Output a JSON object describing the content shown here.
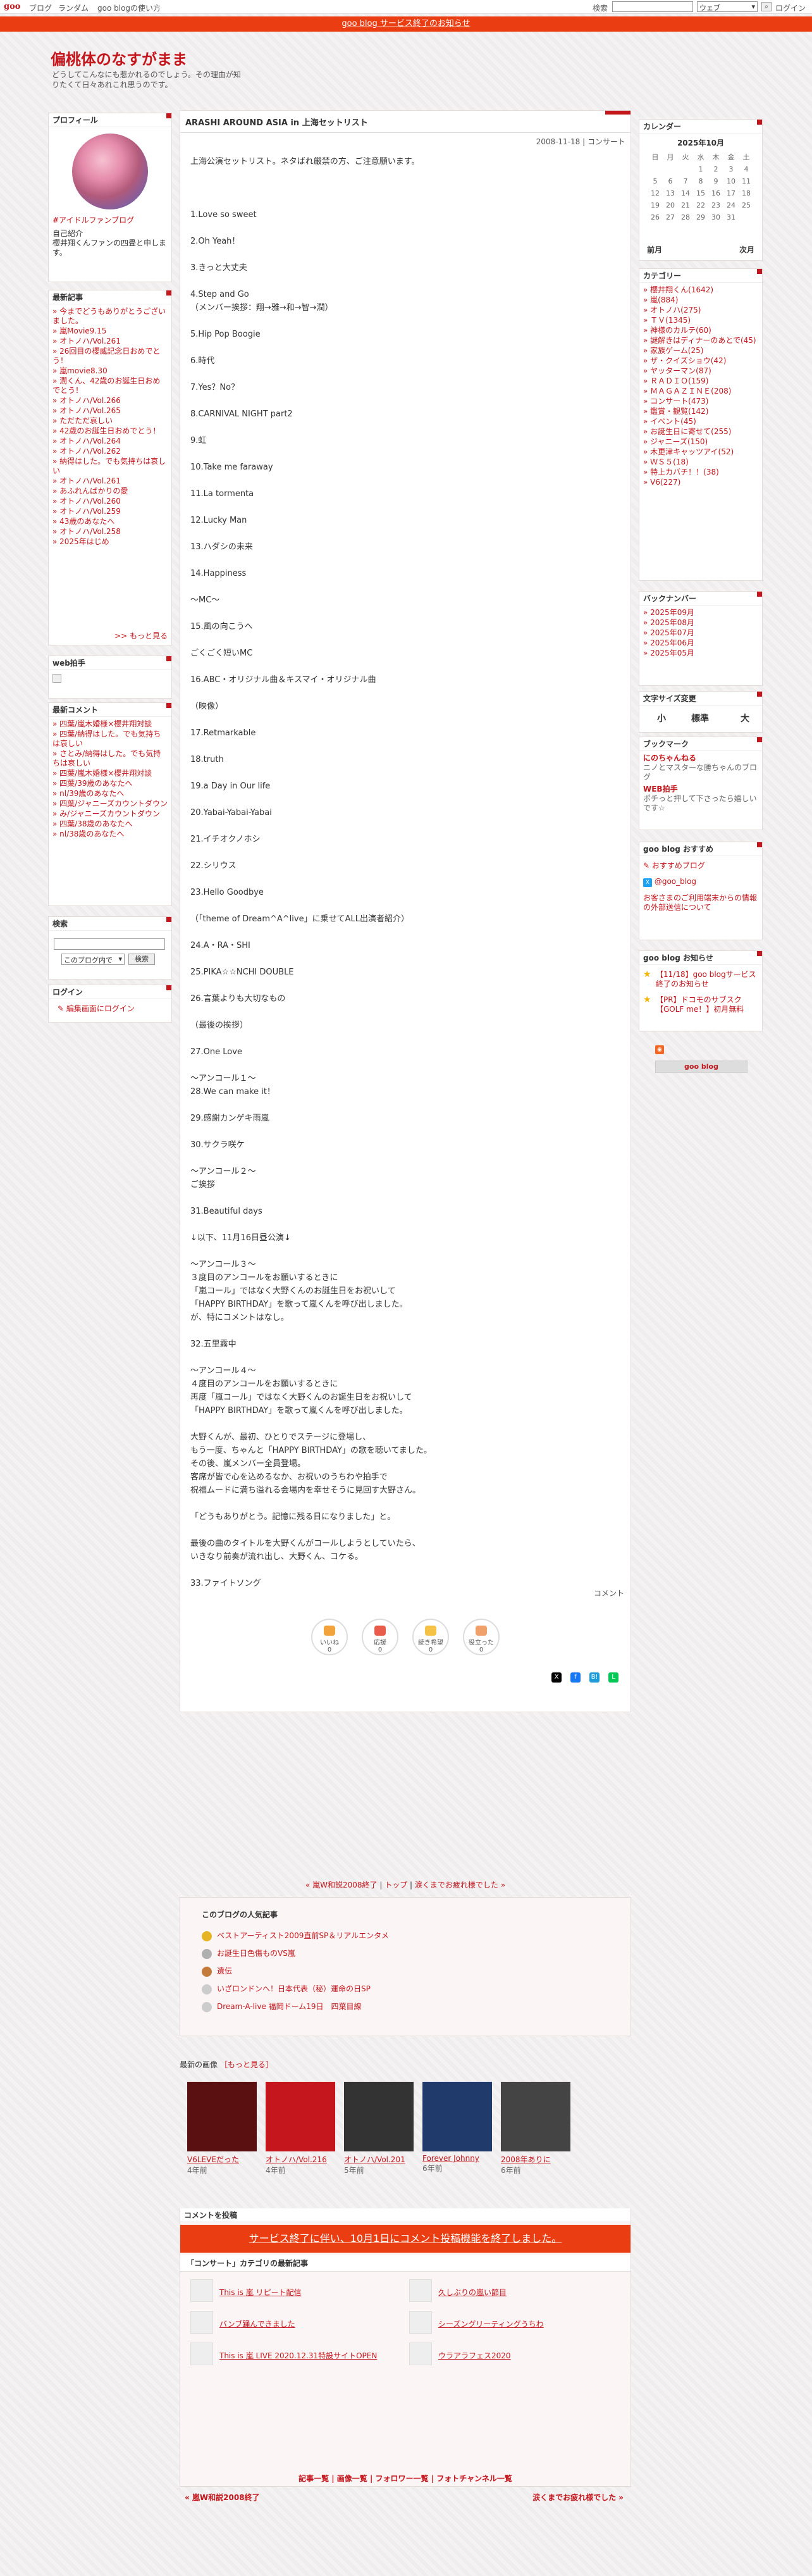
{
  "topbar": {
    "logo": "goo",
    "links": [
      "ブログ",
      "ランダム",
      "goo blogの使い方"
    ],
    "search_label": "検索",
    "search_placeholder": "",
    "search_scope": "ウェブ",
    "login": "ログイン"
  },
  "notice": "goo blog サービス終了のお知らせ",
  "blog": {
    "title": "偏桃体のなすがまま",
    "description": "どうしてこんなにも惹かれるのでしょう。その理由が知りたくて日々あれこれ思うのです。"
  },
  "profile": {
    "heading": "プロフィール",
    "name": "#アイドルファンブログ",
    "intro_label": "自己紹介",
    "intro": "櫻井翔くんファンの四畳と申します。"
  },
  "recent": {
    "heading": "最新記事",
    "items": [
      "今までどうもありがとうございました。",
      "嵐Movie9.15",
      "オトノハ/Vol.261",
      "26回目の櫻威記念日おめでとう！",
      "嵐movie8.30",
      "潤くん、42歳のお誕生日おめでとう！",
      "オトノハ/Vol.266",
      "オトノハ/Vol.265",
      "ただただ哀しい",
      "42歳のお誕生日おめでとう！",
      "オトノハ/Vol.264",
      "オトノハ/Vol.262",
      "納得はした。でも気持ちは哀しい",
      "オトノハ/Vol.261",
      "あふれんばかりの愛",
      "オトノハ/Vol.260",
      "オトノハ/Vol.259",
      "43歳のあなたへ",
      "オトノハ/Vol.258",
      "2025年はじめ"
    ],
    "more": ">> もっと見る"
  },
  "clap": {
    "heading": "web拍手"
  },
  "comments": {
    "heading": "最新コメント",
    "items": [
      "四葉/嵐木婚様×櫻井翔対談",
      "四葉/納得はした。でも気持ちは哀しい",
      "さとみ/納得はした。でも気持ちは哀しい",
      "四葉/嵐木婚様×櫻井翔対談",
      "四葉/39歳のあなたへ",
      "nl/39歳のあなたへ",
      "四葉/ジャニーズカウントダウン",
      "み/ジャニーズカウントダウン",
      "四葉/38歳のあなたへ",
      "nl/38歳のあなたへ"
    ]
  },
  "search": {
    "heading": "検索",
    "scope": "このブログ内で",
    "button": "検索"
  },
  "login": {
    "heading": "ログイン",
    "link": "編集画面にログイン"
  },
  "calendar": {
    "heading": "カレンダー",
    "month": "2025年10月",
    "weekdays": [
      "日",
      "月",
      "火",
      "水",
      "木",
      "金",
      "土"
    ],
    "rows": [
      [
        "",
        "",
        "",
        "1",
        "2",
        "3",
        "4"
      ],
      [
        "5",
        "6",
        "7",
        "8",
        "9",
        "10",
        "11"
      ],
      [
        "12",
        "13",
        "14",
        "15",
        "16",
        "17",
        "18"
      ],
      [
        "19",
        "20",
        "21",
        "22",
        "23",
        "24",
        "25"
      ],
      [
        "26",
        "27",
        "28",
        "29",
        "30",
        "31",
        ""
      ]
    ],
    "prev": "前月",
    "next": "次月"
  },
  "categories": {
    "heading": "カテゴリー",
    "items": [
      "櫻井翔くん(1642)",
      "嵐(884)",
      "オトノハ(275)",
      "ＴＶ(1345)",
      "神様のカルテ(60)",
      "謎解きはディナーのあとで(45)",
      "家族ゲーム(25)",
      "ザ・クイズショウ(42)",
      "ヤッターマン(87)",
      "ＲＡＤＩＯ(159)",
      "ＭＡＧＡＺＩＮＥ(208)",
      "コンサート(473)",
      "鑑賞・観覧(142)",
      "イベント(45)",
      "お誕生日に寄せて(255)",
      "ジャニーズ(150)",
      "木更津キャッツアイ(52)",
      "ＷＳ５(18)",
      "特上カバチ！！(38)",
      "V6(227)"
    ]
  },
  "backnumber": {
    "heading": "バックナンバー",
    "items": [
      "2025年09月",
      "2025年08月",
      "2025年07月",
      "2025年06月",
      "2025年05月"
    ]
  },
  "fontsize": {
    "heading": "文字サイズ変更",
    "small": "小",
    "mid": "標準",
    "large": "大"
  },
  "bookmark": {
    "heading": "ブックマーク",
    "items": [
      {
        "title": "にのちゃんねる",
        "desc": "ニノとマスターな勝ちゃんのブログ"
      },
      {
        "title": "WEB拍手",
        "desc": "ポチっと押して下さったら嬉しいです☆"
      }
    ]
  },
  "recommend": {
    "heading": "goo blog おすすめ",
    "items": [
      "おすすめブログ",
      "@goo_blog",
      "お客さまのご利用端末からの情報の外部送信について"
    ]
  },
  "news": {
    "heading": "goo blog お知らせ",
    "items": [
      "【11/18】goo blogサービス終了のお知らせ",
      "【PR】ドコモのサブスク【GOLF me！】初月無料"
    ]
  },
  "footerlogo": "goo blog",
  "entry": {
    "title": "ARASHI AROUND ASIA in 上海セットリスト",
    "date": "2008-11-18",
    "date_sep": " | ",
    "category": "コンサート",
    "body": "上海公演セットリスト。ネタばれ厳禁の方、ご注意願います。\n\n\n\n1.Love so sweet\n\n2.Oh Yeah！\n\n3.きっと大丈夫\n\n4.Step and Go\n（メンバー挨拶：翔→雅→和→智→潤）\n\n5.Hip Pop Boogie\n\n6.時代\n\n7.Yes？No？\n\n8.CARNIVAL NIGHT part2\n\n9.虹\n\n10.Take me faraway\n\n11.La tormenta\n\n12.Lucky Man\n\n13.ハダシの未来\n\n14.Happiness\n\n〜MC〜\n\n15.風の向こうへ\n\nごくごく短いMC\n\n16.ABC・オリジナル曲＆キスマイ・オリジナル曲\n\n（映像）\n\n17.Retmarkable\n\n18.truth\n\n19.a Day in Our life\n\n20.Yabai-Yabai-Yabai\n\n21.イチオクノホシ\n\n22.シリウス\n\n23.Hello Goodbye\n\n（「theme of Dream^A^live」に乗せてALL出演者紹介）\n\n24.A・RA・SHI\n\n25.PIKA☆☆NCHI DOUBLE\n\n26.言葉よりも大切なもの\n\n（最後の挨拶）\n\n27.One Love\n\n〜アンコール１〜\n28.We can make it！\n\n29.感謝カンゲキ雨嵐\n\n30.サクラ咲ケ\n\n〜アンコール２〜\nご挨拶\n\n31.Beautiful days\n\n↓以下、11月16日昼公演↓\n\n〜アンコール３〜\n３度目のアンコールをお願いするときに\n「嵐コール」ではなく大野くんのお誕生日をお祝いして\n「HAPPY BIRTHDAY」を歌って嵐くんを呼び出しました。\nが、特にコメントはなし。\n\n32.五里霧中\n\n〜アンコール４〜\n４度目のアンコールをお願いするときに\n再度「嵐コール」ではなく大野くんのお誕生日をお祝いして\n「HAPPY BIRTHDAY」を歌って嵐くんを呼び出しました。\n\n大野くんが、最初、ひとりでステージに登場し、\nもう一度、ちゃんと「HAPPY BIRTHDAY」の歌を聴いてました。\nその後、嵐メンバー全員登場。\n客席が皆で心を込めるなか、お祝いのうちわや拍手で\n祝福ムードに満ち溢れる会場内を幸せそうに見回す大野さん。\n\n「どうもありがとう。記憶に残る日になりました」と。\n\n最後の曲のタイトルを大野くんがコールしようとしていたら、\nいきなり前奏が流れ出し、大野くん、コケる。\n\n33.ファイトソング",
    "comment_link": "コメント",
    "reactions": [
      {
        "label": "いいね",
        "count": "0"
      },
      {
        "label": "応援",
        "count": "0"
      },
      {
        "label": "続き希望",
        "count": "0"
      },
      {
        "label": "役立った",
        "count": "0"
      }
    ],
    "share": [
      "X",
      "f",
      "B!",
      "L"
    ]
  },
  "pager": {
    "prev": "« 嵐W和説2008終了",
    "top": "トップ",
    "next": "涙くまでお疲れ様でした »"
  },
  "popular": {
    "heading": "このブログの人気記事",
    "items": [
      "ベストアーティスト2009直前SP＆リアルエンタメ",
      "お誕生日色傷ものVS嵐",
      "遺伝",
      "いざロンドンへ！日本代表（秘）運命の日SP",
      "Dream-A-live 福岡ドーム19日　四葉目線"
    ]
  },
  "images": {
    "heading": "最新の画像",
    "more": "［もっと見る］",
    "items": [
      {
        "caption": "V6LEVEだった",
        "age": "4年前"
      },
      {
        "caption": "オトノハ/Vol.216",
        "age": "4年前"
      },
      {
        "caption": "オトノハ/Vol.201",
        "age": "5年前"
      },
      {
        "caption": "Forever Johnny",
        "age": "6年前"
      },
      {
        "caption": "2008年ありに",
        "age": "6年前"
      }
    ]
  },
  "comment_post": {
    "heading": "コメントを投稿",
    "banner": "サービス終了に伴い、10月1日にコメント投稿機能を終了しました。"
  },
  "catlatest": {
    "heading": "「コンサート」カテゴリの最新記事",
    "items": [
      "This is 嵐 リピート配信",
      "久しぶりの嵐い節目",
      "バンブ踊んできました",
      "シーズングリーティングうちわ",
      "This is 嵐 LIVE 2020.12.31特設サイトOPEN",
      "ウラアラフェス2020"
    ]
  },
  "footer": {
    "links": "記事一覧 | 画像一覧 | フォロワー一覧 | フォトチャンネル一覧",
    "prev": "« 嵐W和説2008終了",
    "next": "涙くまでお疲れ様でした »"
  }
}
